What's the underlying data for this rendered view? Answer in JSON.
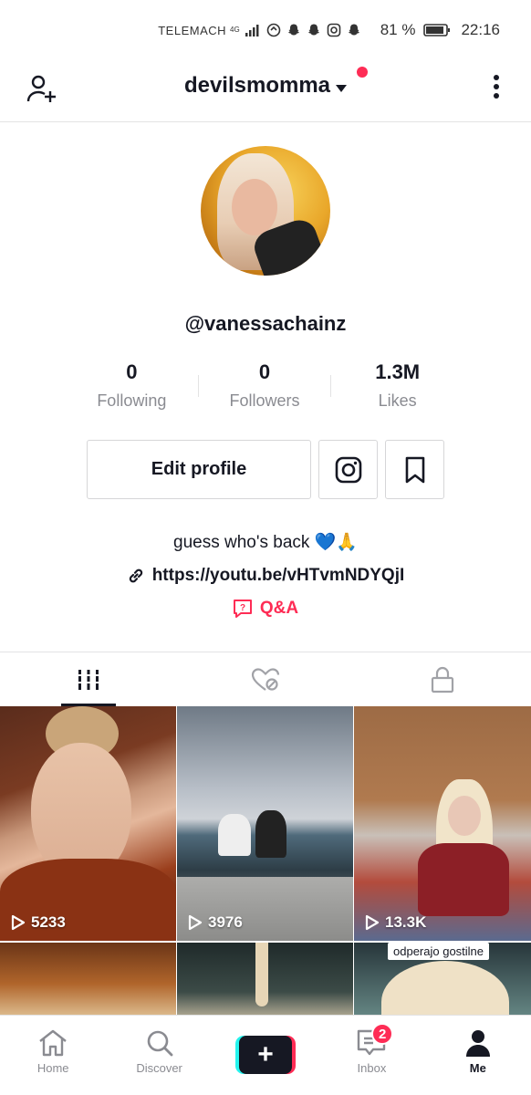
{
  "status_bar": {
    "carrier": "TELEMACH",
    "network": "4G",
    "battery_percent": "81 %",
    "time": "22:16"
  },
  "header": {
    "username": "devilsmomma",
    "icons": [
      "add-user-icon",
      "caret-down-icon",
      "notification-dot",
      "more-vertical-icon"
    ]
  },
  "profile": {
    "handle": "@vanessachainz",
    "stats": [
      {
        "value": "0",
        "label": "Following"
      },
      {
        "value": "0",
        "label": "Followers"
      },
      {
        "value": "1.3M",
        "label": "Likes"
      }
    ],
    "edit_button_label": "Edit profile",
    "bio": "guess who's back 💙🙏",
    "link": "https://youtu.be/vHTvmNDYQjI",
    "qa_label": "Q&A"
  },
  "tabs": [
    {
      "icon": "videos-grid-icon",
      "active": true
    },
    {
      "icon": "liked-hidden-icon",
      "active": false
    },
    {
      "icon": "lock-icon",
      "active": false
    }
  ],
  "videos": [
    {
      "views": "5233"
    },
    {
      "views": "3976"
    },
    {
      "views": "13.3K"
    },
    {
      "views": ""
    },
    {
      "views": ""
    },
    {
      "views": "",
      "caption": "odperajo gostilne"
    }
  ],
  "bottom_nav": [
    {
      "label": "Home",
      "icon": "home-icon"
    },
    {
      "label": "Discover",
      "icon": "search-icon"
    },
    {
      "label": "",
      "icon": "create-icon"
    },
    {
      "label": "Inbox",
      "icon": "inbox-icon",
      "badge": "2"
    },
    {
      "label": "Me",
      "icon": "profile-icon",
      "active": true
    }
  ],
  "colors": {
    "accent": "#fe2c55",
    "text": "#161823",
    "muted": "#8a8b91",
    "create_cyan": "#25f4ee"
  }
}
